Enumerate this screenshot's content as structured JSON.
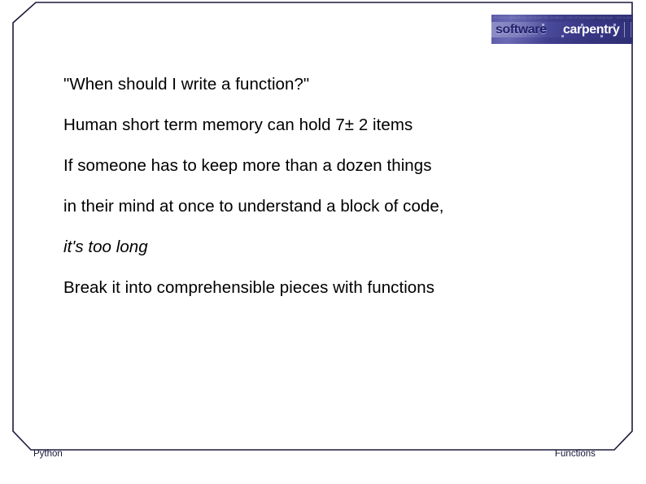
{
  "slide": {
    "background_color": "#ffffff",
    "border_color": "#1a1a3c",
    "text_color": "#000000"
  },
  "logo": {
    "name": "software-carpentry-logo",
    "word_left": "software",
    "word_right": "carpentry",
    "texture_text": "of insert networking; propose the creation - nce of a program language - ext a doc created with",
    "colors": {
      "background_dark": "#30307a",
      "background_light": "#8e8ec6",
      "word_left_color": "#21216e",
      "word_right_color": "#ffffff"
    }
  },
  "content": {
    "lines": [
      {
        "text": "\"When should I write a function?\"",
        "style": "normal"
      },
      {
        "text": "Human short term memory can hold 7± 2 items",
        "style": "normal"
      },
      {
        "text": "If someone has to keep more than a dozen things",
        "style": "normal"
      },
      {
        "text": "in their mind at once to understand a block of code,",
        "style": "normal"
      },
      {
        "text": "it's too long",
        "style": "italic"
      },
      {
        "text": "Break it into comprehensible pieces with functions",
        "style": "normal"
      }
    ]
  },
  "footer": {
    "left_label": "Python",
    "right_label": "Functions"
  }
}
